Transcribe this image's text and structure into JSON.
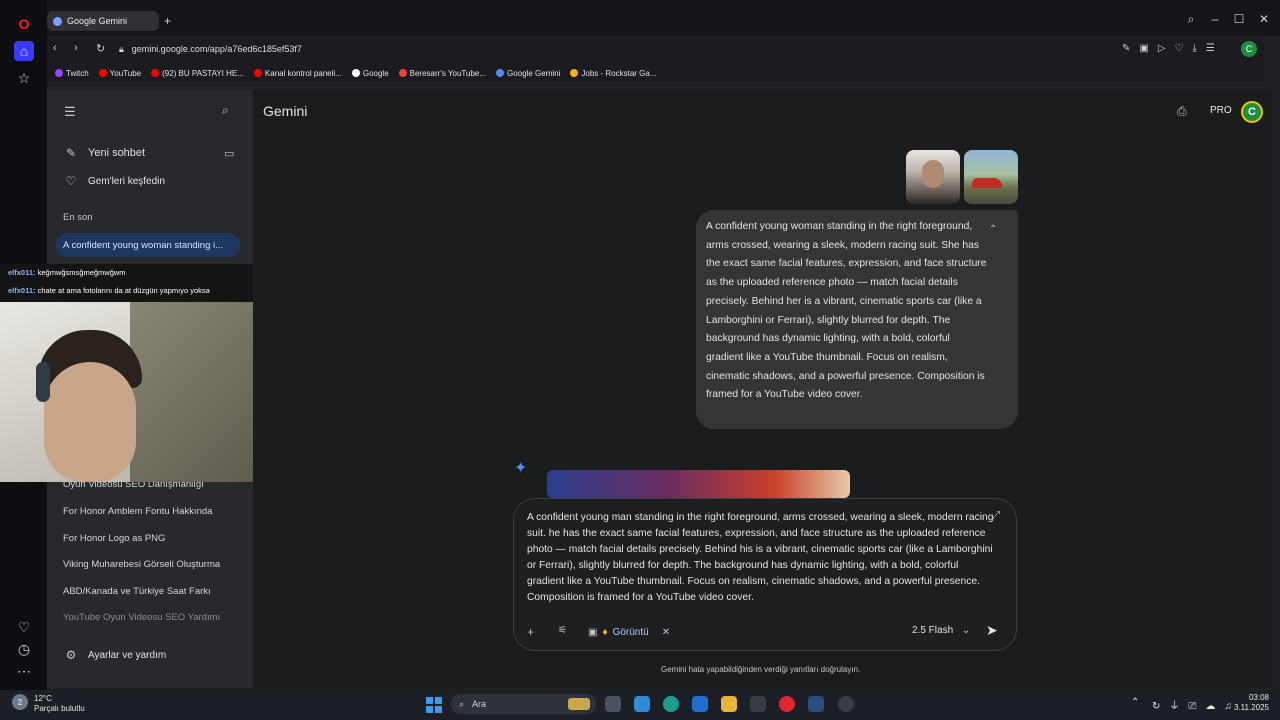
{
  "browser": {
    "tab_title": "Google Gemini",
    "url": "gemini.google.com/app/a76ed6c185ef53f7",
    "bookmarks": [
      {
        "label": "Twitch",
        "color": "#9146ff"
      },
      {
        "label": "YouTube",
        "color": "#ff0000"
      },
      {
        "label": "(92) BU PASTAYI HE...",
        "color": "#ff0000"
      },
      {
        "label": "Kanal kontrol paneli...",
        "color": "#ff0000"
      },
      {
        "label": "Google",
        "color": "#ffffff"
      },
      {
        "label": "Beresarr's YouTube...",
        "color": "#e8453c"
      },
      {
        "label": "Google Gemini",
        "color": "#4c8df6"
      },
      {
        "label": "Jobs - Rockstar Ga...",
        "color": "#fcaf17"
      }
    ]
  },
  "sidebar": {
    "new_chat": "Yeni sohbet",
    "explore_gems": "Gem'leri keşfedin",
    "recent_header": "En son",
    "active_chat": "A confident young woman standing i...",
    "history": [
      "Oyun Videosu SEO Danışmanlığı",
      "For Honor Amblem Fontu Hakkında",
      "For Honor Logo as PNG",
      "Viking Muharebesi Görseli Oluşturma",
      "ABD/Kanada ve Türkiye Saat Farkı",
      "YouTube Oyun Videosu SEO Yardımı"
    ],
    "settings": "Ayarlar ve yardım"
  },
  "stream_chat": [
    {
      "user": "elfx011:",
      "text": "keğmwğsmsğmeğmwğwm"
    },
    {
      "user": "elfx011:",
      "text": "chate at ama fotolarını da at düzgün yapmıyo yoksa"
    }
  ],
  "header": {
    "title": "Gemini",
    "pro_label": "PRO",
    "avatar_letter": "C"
  },
  "conversation": {
    "user_message": "A confident young woman standing in the right foreground, arms crossed, wearing a sleek, modern racing suit. She has the exact same facial features, expression, and face structure as the uploaded reference photo — match facial details precisely. Behind her is a vibrant, cinematic sports car (like a Lamborghini or Ferrari), slightly blurred for depth. The background has dynamic lighting, with a bold, colorful gradient like a YouTube thumbnail. Focus on realism, cinematic shadows, and a powerful presence. Composition is framed for a YouTube video cover."
  },
  "composer": {
    "prompt_text": "A confident young man standing in the right foreground, arms crossed, wearing a sleek, modern racing suit. he has the exact same facial features, expression, and face structure as the uploaded reference photo — match facial details precisely. Behind his is a vibrant, cinematic sports car (like a Lamborghini or Ferrari), slightly blurred for depth. The background has dynamic lighting, with a bold, colorful gradient like a YouTube thumbnail. Focus on realism, cinematic shadows, and a powerful presence. Composition is framed for a YouTube video cover.",
    "tool_chip": "Görüntü",
    "model": "2.5 Flash",
    "disclaimer": "Gemini hata yapabildiğinden verdiği yanıtları doğrulayın."
  },
  "taskbar": {
    "temperature": "12°C",
    "weather_text": "Parçalı bulutlu",
    "weather_badge": "2",
    "search_placeholder": "Ara",
    "time": "03:08",
    "date": "3.11.2025"
  }
}
